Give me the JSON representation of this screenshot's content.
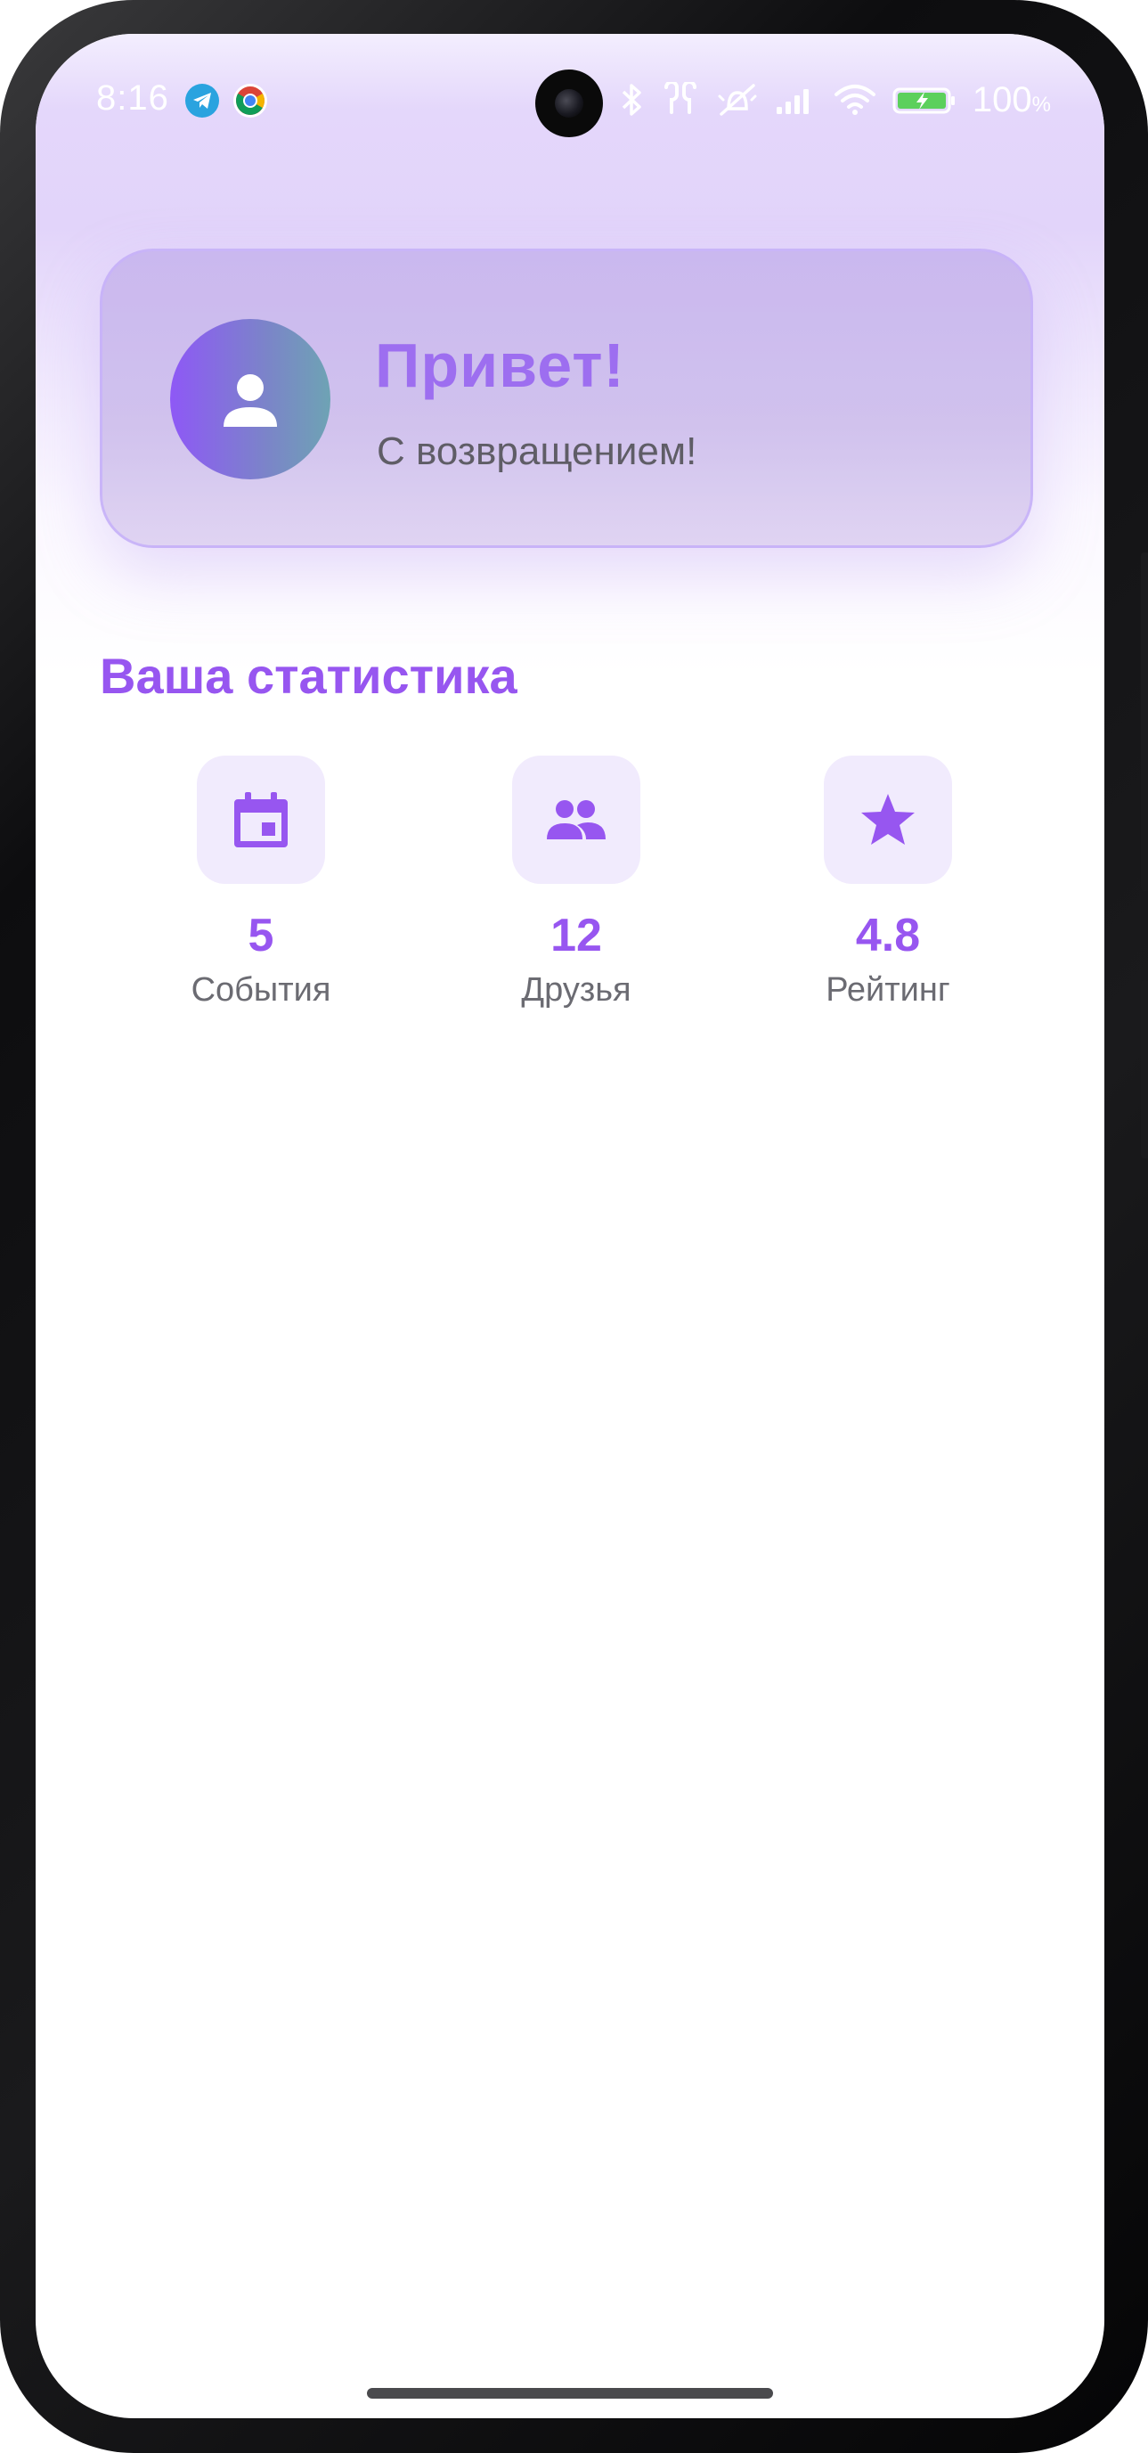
{
  "status_bar": {
    "time": "8:16",
    "battery_percent": "100",
    "battery_unit": "%",
    "apps": [
      "telegram-icon",
      "chrome-icon"
    ],
    "icons": [
      "bluetooth-icon",
      "earbuds-icon",
      "vibrate-off-icon",
      "signal-icon",
      "wifi-icon",
      "battery-charging-icon"
    ]
  },
  "welcome": {
    "title": "Привет!",
    "subtitle": "С возвращением!"
  },
  "stats": {
    "title": "Ваша статистика",
    "items": [
      {
        "icon": "calendar-icon",
        "value": "5",
        "label": "События"
      },
      {
        "icon": "people-icon",
        "value": "12",
        "label": "Друзья"
      },
      {
        "icon": "star-icon",
        "value": "4.8",
        "label": "Рейтинг"
      }
    ]
  },
  "colors": {
    "accent": "#9756f0",
    "title": "#9d6ef0",
    "icon_box": "#f1ebfd",
    "label": "#6b6b72"
  }
}
